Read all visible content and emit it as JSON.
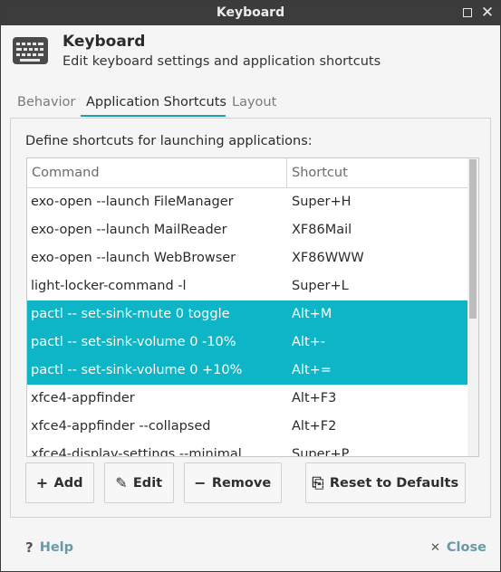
{
  "window": {
    "title": "Keyboard",
    "maximize_icon": "maximize-icon",
    "close_icon": "close-icon"
  },
  "header": {
    "icon": "keyboard-icon",
    "title": "Keyboard",
    "subtitle": "Edit keyboard settings and application shortcuts"
  },
  "tabs": [
    {
      "label": "Behavior",
      "active": false
    },
    {
      "label": "Application Shortcuts",
      "active": true
    },
    {
      "label": "Layout",
      "active": false
    }
  ],
  "panel": {
    "caption": "Define shortcuts for launching applications:",
    "columns": {
      "command": "Command",
      "shortcut": "Shortcut"
    },
    "rows": [
      {
        "command": "exo-open --launch FileManager",
        "shortcut": "Super+H",
        "selected": false
      },
      {
        "command": "exo-open --launch MailReader",
        "shortcut": "XF86Mail",
        "selected": false
      },
      {
        "command": "exo-open --launch WebBrowser",
        "shortcut": "XF86WWW",
        "selected": false
      },
      {
        "command": "light-locker-command -l",
        "shortcut": "Super+L",
        "selected": false
      },
      {
        "command": "pactl -- set-sink-mute 0 toggle",
        "shortcut": "Alt+M",
        "selected": true
      },
      {
        "command": "pactl -- set-sink-volume 0 -10%",
        "shortcut": "Alt+-",
        "selected": true
      },
      {
        "command": "pactl -- set-sink-volume 0 +10%",
        "shortcut": "Alt+=",
        "selected": true
      },
      {
        "command": "xfce4-appfinder",
        "shortcut": "Alt+F3",
        "selected": false
      },
      {
        "command": "xfce4-appfinder --collapsed",
        "shortcut": "Alt+F2",
        "selected": false
      },
      {
        "command": "xfce4-display-settings --minimal",
        "shortcut": "Super+P",
        "selected": false
      }
    ],
    "selection_color": "#0eb5c7"
  },
  "buttons": {
    "add": {
      "label": "Add",
      "icon": "plus-icon",
      "glyph": "+"
    },
    "edit": {
      "label": "Edit",
      "icon": "pencil-icon",
      "glyph": "✎"
    },
    "remove": {
      "label": "Remove",
      "icon": "minus-icon",
      "glyph": "−"
    },
    "reset": {
      "label": "Reset to Defaults",
      "icon": "document-revert-icon",
      "glyph": "⎘"
    }
  },
  "footer": {
    "help": {
      "label": "Help",
      "icon": "help-icon",
      "glyph": "?"
    },
    "close": {
      "label": "Close",
      "icon": "close-icon",
      "glyph": "✕"
    }
  },
  "colors": {
    "accent": "#1b9fb4",
    "titlebar": "#3c3c3c",
    "link": "#6a99a6"
  }
}
